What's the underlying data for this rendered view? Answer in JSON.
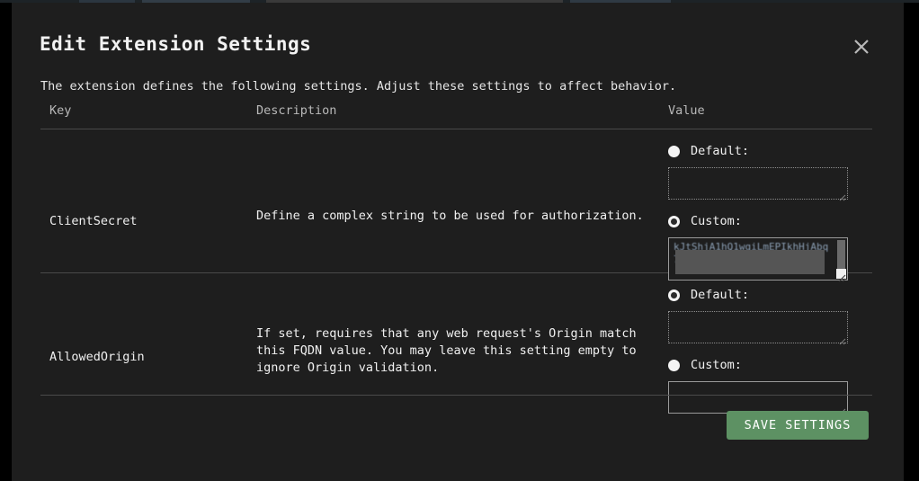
{
  "modal": {
    "title": "Edit Extension Settings",
    "close_icon": "close-icon",
    "subtitle": "The extension defines the following settings. Adjust these settings to affect behavior.",
    "accent_color": "#5d9163",
    "background_color": "#1e1e1e",
    "text_color": "#f0f0f0"
  },
  "table": {
    "headers": {
      "key": "Key",
      "description": "Description",
      "value": "Value"
    },
    "rows": [
      {
        "key": "ClientSecret",
        "description": "Define a complex string to be used for authorization.",
        "options": [
          {
            "label": "Default:",
            "selected": false,
            "field_value": "",
            "field_enabled": false,
            "redacted": false
          },
          {
            "label": "Custom:",
            "selected": true,
            "field_value": "",
            "field_enabled": true,
            "redacted": true
          }
        ]
      },
      {
        "key": "AllowedOrigin",
        "description": "If set, requires that any web request's Origin match this FQDN value. You may leave this setting empty to ignore Origin validation.",
        "options": [
          {
            "label": "Default:",
            "selected": true,
            "field_value": "",
            "field_enabled": false,
            "redacted": false
          },
          {
            "label": "Custom:",
            "selected": false,
            "field_value": "",
            "field_enabled": true,
            "redacted": false
          }
        ]
      }
    ]
  },
  "footer": {
    "save_label": "SAVE SETTINGS"
  }
}
